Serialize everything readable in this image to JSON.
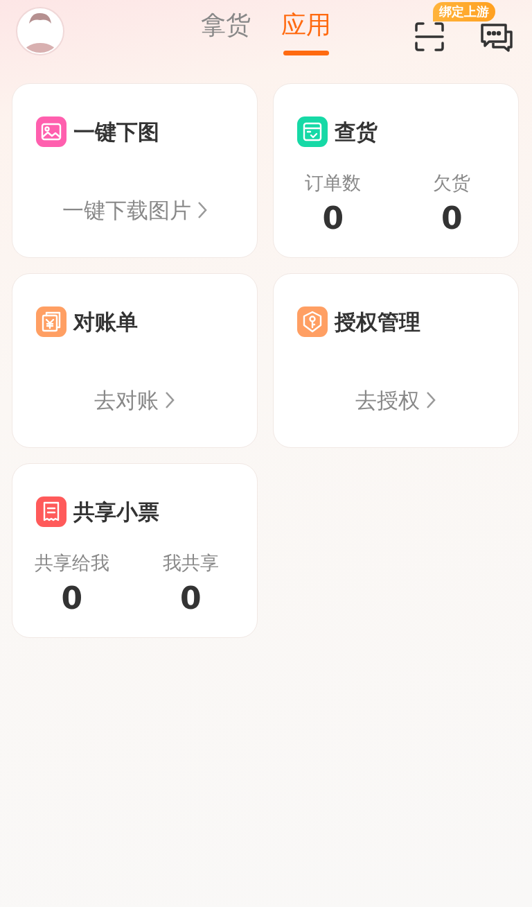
{
  "tabs": [
    {
      "label": "拿货",
      "selected": false
    },
    {
      "label": "应用",
      "selected": true
    }
  ],
  "scan_badge": "绑定上游",
  "cards": [
    {
      "kind": "link",
      "color": "#ff5fae",
      "title": "一键下图",
      "link": "一键下载图片"
    },
    {
      "kind": "stats",
      "color": "#16d9a6",
      "title": "查货",
      "stats": [
        {
          "label": "订单数",
          "value": "0"
        },
        {
          "label": "欠货",
          "value": "0"
        }
      ]
    },
    {
      "kind": "link",
      "color": "#ff9f63",
      "title": "对账单",
      "link": "去对账"
    },
    {
      "kind": "link",
      "color": "#ff9f63",
      "title": "授权管理",
      "link": "去授权"
    },
    {
      "kind": "stats",
      "color": "#ff5a5a",
      "title": "共享小票",
      "stats": [
        {
          "label": "共享给我",
          "value": "0"
        },
        {
          "label": "我共享",
          "value": "0"
        }
      ]
    }
  ]
}
